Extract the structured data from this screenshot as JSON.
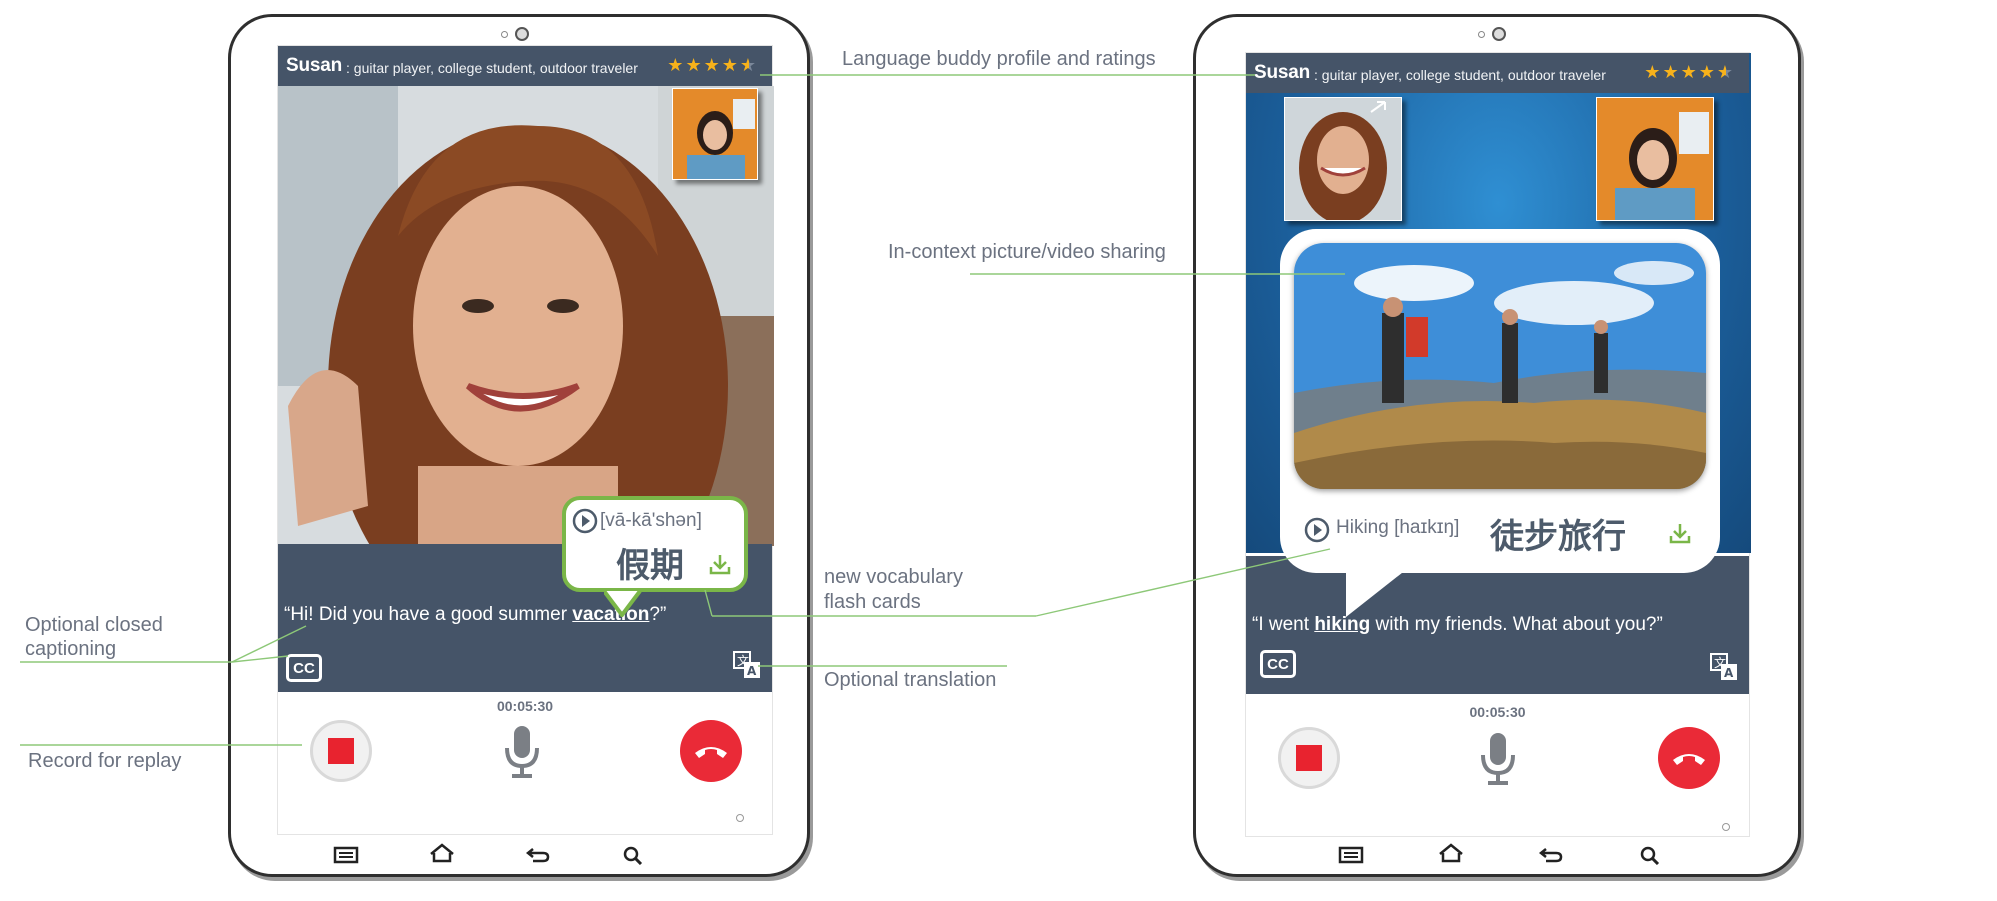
{
  "left_screen": {
    "profile": {
      "name": "Susan",
      "description": ": guitar player, college student, outdoor traveler"
    },
    "vocab_card": {
      "pronunciation": "[vā-kā'shən]",
      "characters": "假期"
    },
    "caption": {
      "before": "“Hi! Did you have a good summer ",
      "highlight": "vacation",
      "after": "?”"
    },
    "cc_label": "CC",
    "timer": "00:05:30",
    "rating": 4.5
  },
  "right_screen": {
    "profile": {
      "name": "Susan",
      "description": ": guitar player, college student, outdoor traveler"
    },
    "vocab_card": {
      "word": "Hiking [haɪkɪŋ]",
      "characters": "徒步旅行"
    },
    "caption": {
      "before": "“I went ",
      "highlight": "hiking",
      "after": " with my friends.  What about you?”"
    },
    "cc_label": "CC",
    "timer": "00:05:30",
    "rating": 4.5
  },
  "annotations": {
    "profile_ratings": "Language buddy profile and ratings",
    "picture_sharing": "In-context picture/video sharing",
    "vocab_line1": "new vocabulary",
    "vocab_line2": "flash cards",
    "cc_line1": "Optional closed",
    "cc_line2": "captioning",
    "translation": "Optional translation",
    "record": "Record for replay"
  },
  "colors": {
    "panel": "#455468",
    "accent_green": "#7ab648",
    "star": "#f7b21b",
    "hangup_red": "#ea2a37",
    "leader_line": "#8dc878"
  },
  "icons": [
    "camera-icon",
    "star-icon",
    "play-icon",
    "download-icon",
    "cc-icon",
    "translate-icon",
    "stop-record-icon",
    "microphone-icon",
    "hang-up-icon",
    "menu-icon",
    "home-icon",
    "back-icon",
    "search-icon"
  ]
}
